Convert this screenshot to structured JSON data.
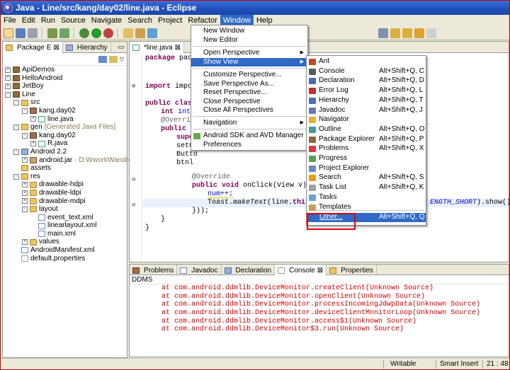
{
  "window": {
    "title": "Java - Line/src/kang/day02/line.java - Eclipse"
  },
  "menubar": [
    "File",
    "Edit",
    "Run",
    "Source",
    "Navigate",
    "Search",
    "Project",
    "Refactor",
    "Window",
    "Help"
  ],
  "left_panel": {
    "tabs": [
      "Package E",
      "Hierarchy"
    ],
    "tree": [
      {
        "label": "ApiDemos",
        "depth": 0,
        "icon": "project",
        "toggle": "+"
      },
      {
        "label": "HelloAndroid",
        "depth": 0,
        "icon": "project",
        "toggle": "+"
      },
      {
        "label": "JetBoy",
        "depth": 0,
        "icon": "project",
        "toggle": "+"
      },
      {
        "label": "Line",
        "depth": 0,
        "icon": "project",
        "toggle": "-"
      },
      {
        "label": "src",
        "depth": 1,
        "icon": "folder",
        "toggle": "-"
      },
      {
        "label": "kang.day02",
        "depth": 2,
        "icon": "package",
        "toggle": "-"
      },
      {
        "label": "line.java",
        "depth": 3,
        "icon": "java",
        "toggle": "+"
      },
      {
        "label": "gen",
        "depth": 1,
        "icon": "folder",
        "toggle": "-",
        "note": "[Generated Java Files]"
      },
      {
        "label": "kang.day02",
        "depth": 2,
        "icon": "package",
        "toggle": "-"
      },
      {
        "label": "R.java",
        "depth": 3,
        "icon": "java",
        "toggle": "+"
      },
      {
        "label": "Android 2.2",
        "depth": 1,
        "icon": "library",
        "toggle": "-"
      },
      {
        "label": "android.jar",
        "depth": 2,
        "icon": "jar",
        "toggle": "+",
        "note": "- D:WworkWandro"
      },
      {
        "label": "assets",
        "depth": 1,
        "icon": "folder",
        "toggle": ""
      },
      {
        "label": "res",
        "depth": 1,
        "icon": "folder",
        "toggle": "-"
      },
      {
        "label": "drawable-hdpi",
        "depth": 2,
        "icon": "folder",
        "toggle": "+"
      },
      {
        "label": "drawable-ldpi",
        "depth": 2,
        "icon": "folder",
        "toggle": "+"
      },
      {
        "label": "drawable-mdpi",
        "depth": 2,
        "icon": "folder",
        "toggle": "+"
      },
      {
        "label": "layout",
        "depth": 2,
        "icon": "folder",
        "toggle": "-"
      },
      {
        "label": "event_text.xml",
        "depth": 3,
        "icon": "xml",
        "toggle": ""
      },
      {
        "label": "linearlayout.xml",
        "depth": 3,
        "icon": "xml",
        "toggle": ""
      },
      {
        "label": "main.xml",
        "depth": 3,
        "icon": "xml",
        "toggle": ""
      },
      {
        "label": "values",
        "depth": 2,
        "icon": "folder",
        "toggle": "+"
      },
      {
        "label": "AndroidManifest.xml",
        "depth": 1,
        "icon": "xml",
        "toggle": ""
      },
      {
        "label": "default.properties",
        "depth": 1,
        "icon": "file",
        "toggle": ""
      }
    ]
  },
  "editor": {
    "tab": "*line.java",
    "code": {
      "l1": "package kang",
      "l2": "import androi",
      "l3a": "public class",
      "l4a": "int num;",
      "l5": "@Override",
      "l6a": "public v",
      "l7a": "super",
      "l8a": "setCo",
      "l9a": "Butto",
      "l10a": "btnl",
      "l11": "@Override",
      "l12a": "public void",
      "l12b": " onClick(View v) {",
      "l13": "num++;",
      "l14a": "Toast.",
      "l14b": "makeText",
      "l14c": "(line.",
      "l14d": "this",
      "l14e": ",",
      "l14f": "ENGTH_SHORT",
      "l14g": ").show();",
      "l15": "}));",
      "l16": "}",
      "l17": "}"
    }
  },
  "bottom_panel": {
    "tabs": [
      "Problems",
      "Javadoc",
      "Declaration",
      "Console",
      "Properties"
    ],
    "ddms_label": "DDMS",
    "console_lines": [
      "at com.android.ddmlib.DeviceMonitor.createClient(Unknown Source)",
      "at com.android.ddmlib.DeviceMonitor.openClient(Unknown Source)",
      "at com.android.ddmlib.DeviceMonitor.processIncomingJdwpData(Unknown Source)",
      "at com.android.ddmlib.DeviceMonitor.deviceClientMonitorLoop(Unknown Source)",
      "at com.android.ddmlib.DeviceMonitor.access$1(Unknown Source)",
      "at com.android.ddmlib.DeviceMonitor$3.run(Unknown Source)"
    ]
  },
  "status_bar": {
    "writable": "Writable",
    "insert_mode": "Smart Insert",
    "position": "21 : 48"
  },
  "window_menu": {
    "items": [
      {
        "label": "New Window",
        "u": "N"
      },
      {
        "label": "New Editor",
        "u": "E"
      },
      {
        "label": "Open Perspective",
        "u": "O",
        "submenu": true
      },
      {
        "label": "Show View",
        "u": "V",
        "submenu": true
      },
      {
        "label": "Customize Perspective...",
        "u": "z"
      },
      {
        "label": "Save Perspective As...",
        "u": "A"
      },
      {
        "label": "Reset Perspective...",
        "u": "R"
      },
      {
        "label": "Close Perspective",
        "u": "C"
      },
      {
        "label": "Close All Perspectives",
        "u": "l"
      },
      {
        "label": "Navigation",
        "u": "g",
        "submenu": true
      },
      {
        "label": "Android SDK and AVD Manager",
        "u": ""
      },
      {
        "label": "Preferences",
        "u": "P"
      }
    ]
  },
  "show_view_menu": {
    "items": [
      {
        "label": "Ant",
        "accel": ""
      },
      {
        "label": "Console",
        "accel": "Alt+Shift+Q, C"
      },
      {
        "label": "Declaration",
        "accel": "Alt+Shift+Q, D"
      },
      {
        "label": "Error Log",
        "accel": "Alt+Shift+Q, L"
      },
      {
        "label": "Hierarchy",
        "accel": "Alt+Shift+Q, T"
      },
      {
        "label": "Javadoc",
        "accel": "Alt+Shift+Q, J"
      },
      {
        "label": "Navigator",
        "accel": ""
      },
      {
        "label": "Outline",
        "accel": "Alt+Shift+Q, O"
      },
      {
        "label": "Package Explorer",
        "accel": "Alt+Shift+Q, P"
      },
      {
        "label": "Problems",
        "accel": "Alt+Shift+Q, X"
      },
      {
        "label": "Progress",
        "accel": ""
      },
      {
        "label": "Project Explorer",
        "accel": ""
      },
      {
        "label": "Search",
        "accel": "Alt+Shift+Q, S"
      },
      {
        "label": "Task List",
        "accel": "Alt+Shift+Q, K"
      },
      {
        "label": "Tasks",
        "accel": ""
      },
      {
        "label": "Templates",
        "accel": ""
      },
      {
        "label": "Other...",
        "accel": "Alt+Shift+Q, Q"
      }
    ]
  },
  "colors": {
    "selection": "#316ac5",
    "highlight_box": "#e00000",
    "console_error": "#cc0000",
    "keyword": "#7f0055"
  }
}
